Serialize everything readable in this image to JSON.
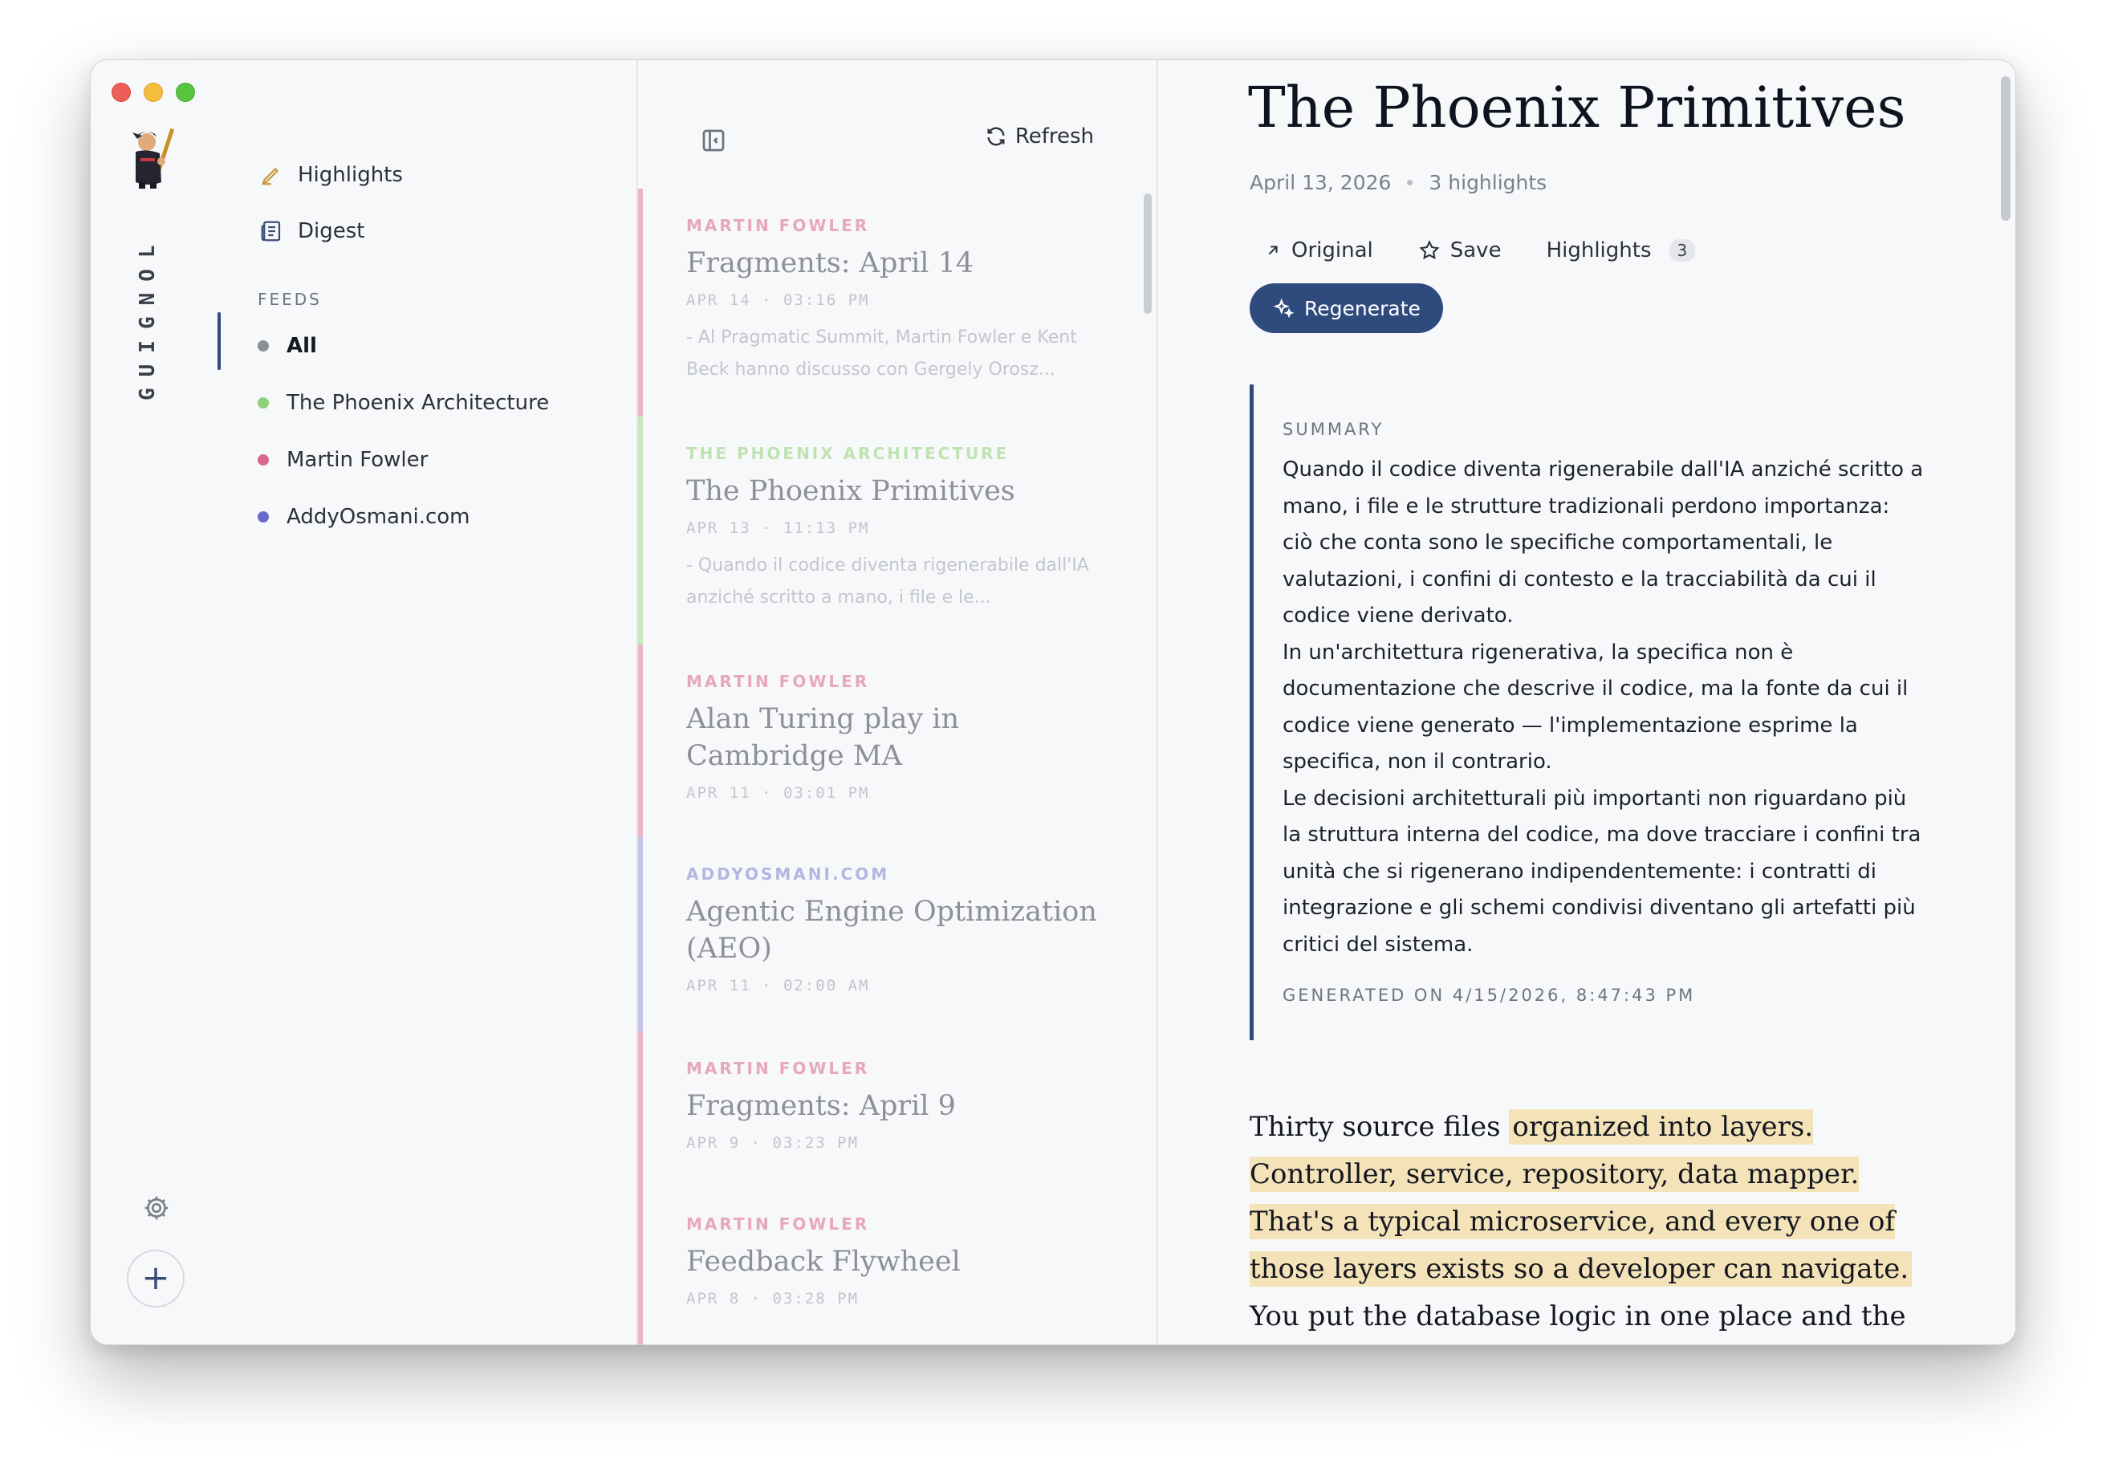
{
  "app": {
    "brand": "GUIGNOL"
  },
  "nav": {
    "highlights": "Highlights",
    "digest": "Digest",
    "feeds_label": "FEEDS",
    "feeds": [
      {
        "label": "All",
        "color": "#8a8f99",
        "active": true
      },
      {
        "label": "The Phoenix Architecture",
        "color": "#8fd07a",
        "active": false
      },
      {
        "label": "Martin Fowler",
        "color": "#d76a8c",
        "active": false
      },
      {
        "label": "AddyOsmani.com",
        "color": "#6a68c8",
        "active": false
      }
    ]
  },
  "list": {
    "refresh_label": "Refresh",
    "items": [
      {
        "source": "MARTIN FOWLER",
        "source_color": "#e6a7bf",
        "bar_color": "#e7b6c9",
        "title": "Fragments: April 14",
        "meta": "APR 14 · 03:16 PM",
        "excerpt": "- Al Pragmatic Summit, Martin Fowler e Kent Beck hanno discusso con Gergely Orosz..."
      },
      {
        "source": "THE PHOENIX ARCHITECTURE",
        "source_color": "#bfe3b0",
        "bar_color": "#c9e8bd",
        "title": "The Phoenix Primitives",
        "meta": "APR 13 · 11:13 PM",
        "excerpt": "- Quando il codice diventa rigenerabile dall'IA anziché scritto a mano, i file e le..."
      },
      {
        "source": "MARTIN FOWLER",
        "source_color": "#e6a7bf",
        "bar_color": "#e7b6c9",
        "title": "Alan Turing play in Cambridge MA",
        "meta": "APR 11 · 03:01 PM",
        "excerpt": ""
      },
      {
        "source": "ADDYOSMANI.COM",
        "source_color": "#b4b6e2",
        "bar_color": "#c3c4ea",
        "title": "Agentic Engine Optimization (AEO)",
        "meta": "APR 11 · 02:00 AM",
        "excerpt": ""
      },
      {
        "source": "MARTIN FOWLER",
        "source_color": "#e6a7bf",
        "bar_color": "#e7b6c9",
        "title": "Fragments: April 9",
        "meta": "APR 9 · 03:23 PM",
        "excerpt": ""
      },
      {
        "source": "MARTIN FOWLER",
        "source_color": "#e6a7bf",
        "bar_color": "#e7b6c9",
        "title": "Feedback Flywheel",
        "meta": "APR 8 · 03:28 PM",
        "excerpt": ""
      }
    ]
  },
  "article": {
    "title": "The Phoenix Primitives",
    "date": "April 13, 2026",
    "highlights_count_text": "3 highlights",
    "actions": {
      "original": "Original",
      "save": "Save",
      "highlights": "Highlights",
      "highlights_badge": "3"
    },
    "regenerate": "Regenerate",
    "summary": {
      "label": "SUMMARY",
      "p1": "Quando il codice diventa rigenerabile dall'IA anziché scritto a mano, i file e le strutture tradizionali perdono importanza: ciò che conta sono le specifiche comportamentali, le valutazioni, i confini di contesto e la tracciabilità da cui il codice viene derivato.",
      "p2": "In un'architettura rigenerativa, la specifica non è documentazione che descrive il codice, ma la fonte da cui il codice viene generato — l'implementazione esprime la specifica, non il contrario.",
      "p3": "Le decisioni architetturali più importanti non riguardano più la struttura interna del codice, ma dove tracciare i confini tra unità che si rigenerano indipendentemente: i contratti di integrazione e gli schemi condivisi diventano gli artefatti più critici del sistema.",
      "generated": "GENERATED ON 4/15/2026, 8:47:43 PM"
    },
    "body": {
      "lead": "Thirty source files ",
      "highlight": "organized into layers. Controller, service, repository, data mapper. That's a typical microservice, and every one of those layers exists so a developer can navigate.",
      "rest": " You put the database logic in one place and the HTTP handling in another because"
    }
  }
}
